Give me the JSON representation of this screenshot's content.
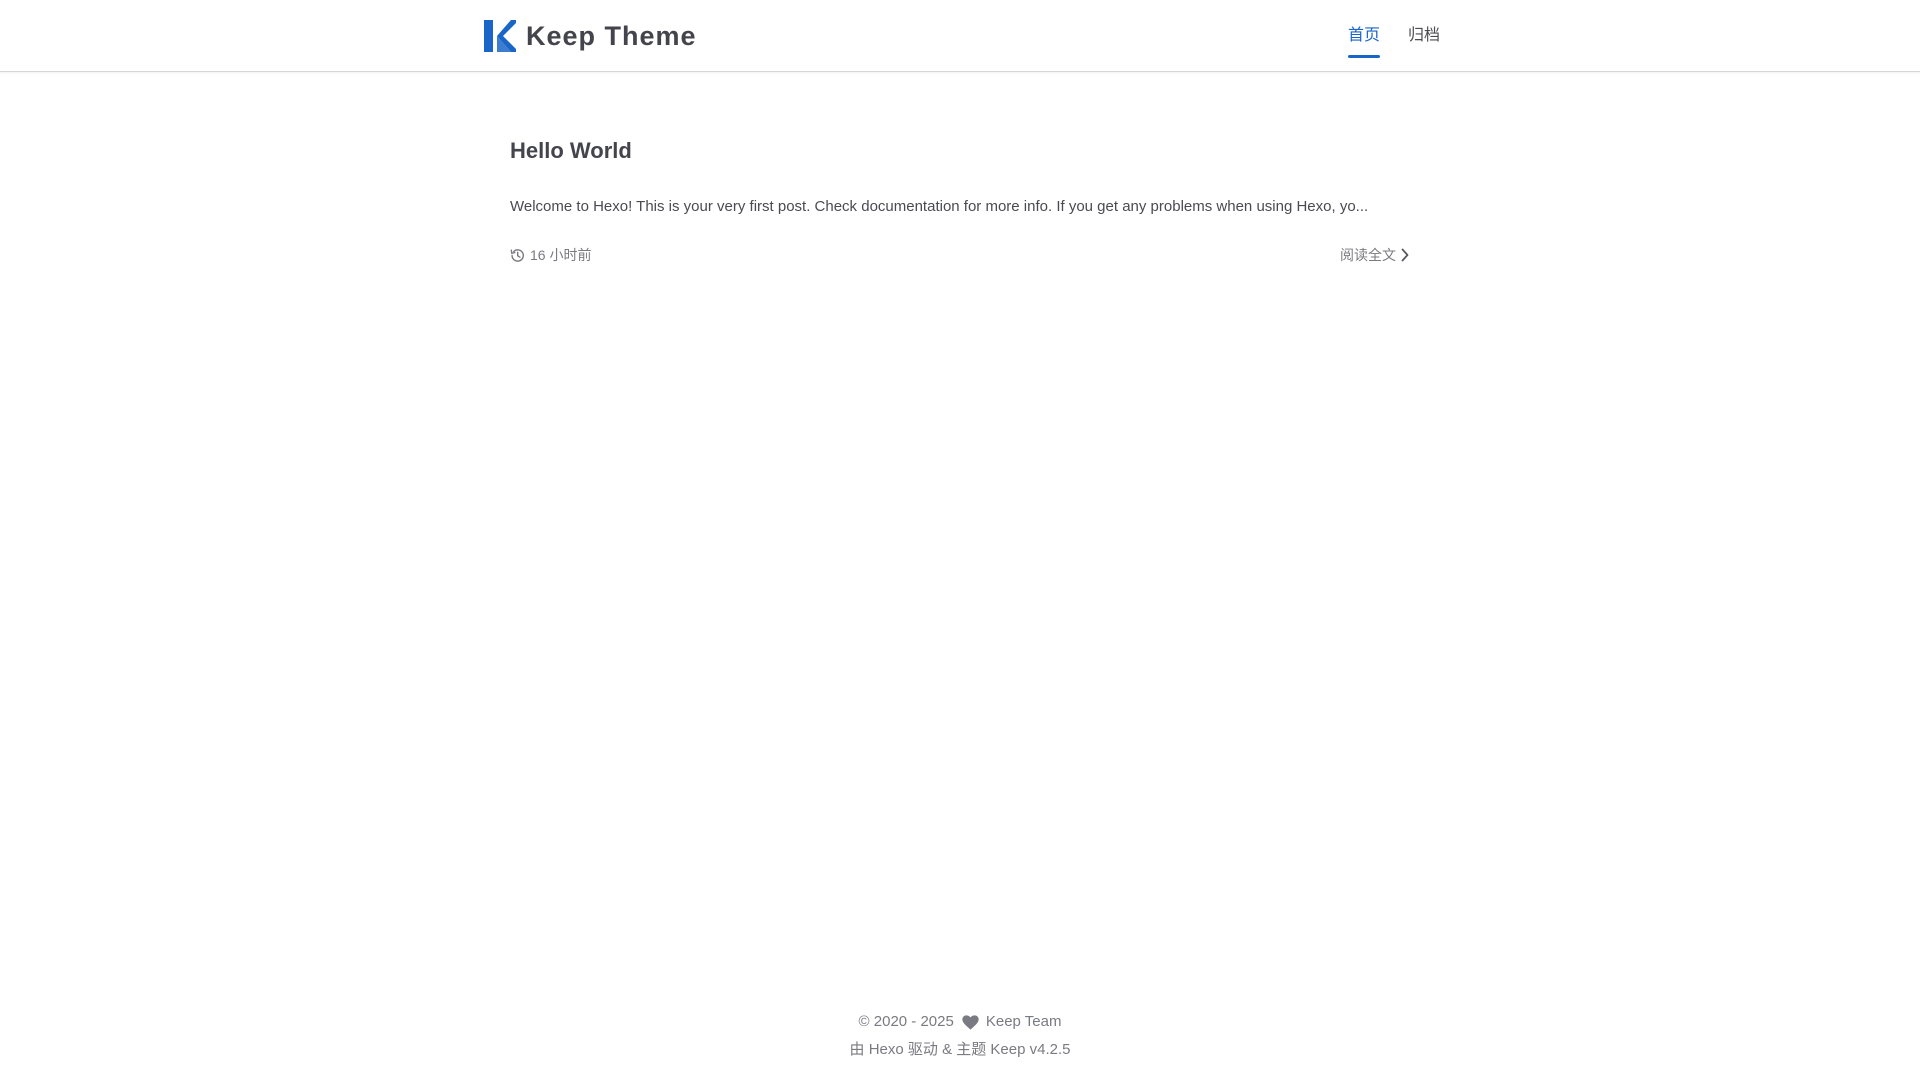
{
  "header": {
    "site_title": "Keep Theme",
    "logo_icon": "keep-k-logo",
    "nav": [
      {
        "label": "首页",
        "active": true
      },
      {
        "label": "归档",
        "active": false
      }
    ]
  },
  "post": {
    "title": "Hello World",
    "excerpt": "Welcome to Hexo! This is your very first post. Check documentation for more info. If you get any problems when using Hexo, yo...",
    "time": "16 小时前",
    "time_icon": "history-icon",
    "read_more": "阅读全文",
    "read_more_icon": "chevron-right-icon"
  },
  "footer": {
    "copyright": "© 2020 - 2025",
    "heart_icon": "heart-icon",
    "team": "Keep Team",
    "powered_prefix": "由",
    "powered_hexo": "Hexo",
    "powered_mid": "驱动 &amp; 主题",
    "powered_keep": "Keep v4.2.5"
  },
  "colors": {
    "accent": "#1a66c8",
    "text": "#4a4a52",
    "muted": "#7a7a82",
    "heart": "#7a7a82"
  }
}
